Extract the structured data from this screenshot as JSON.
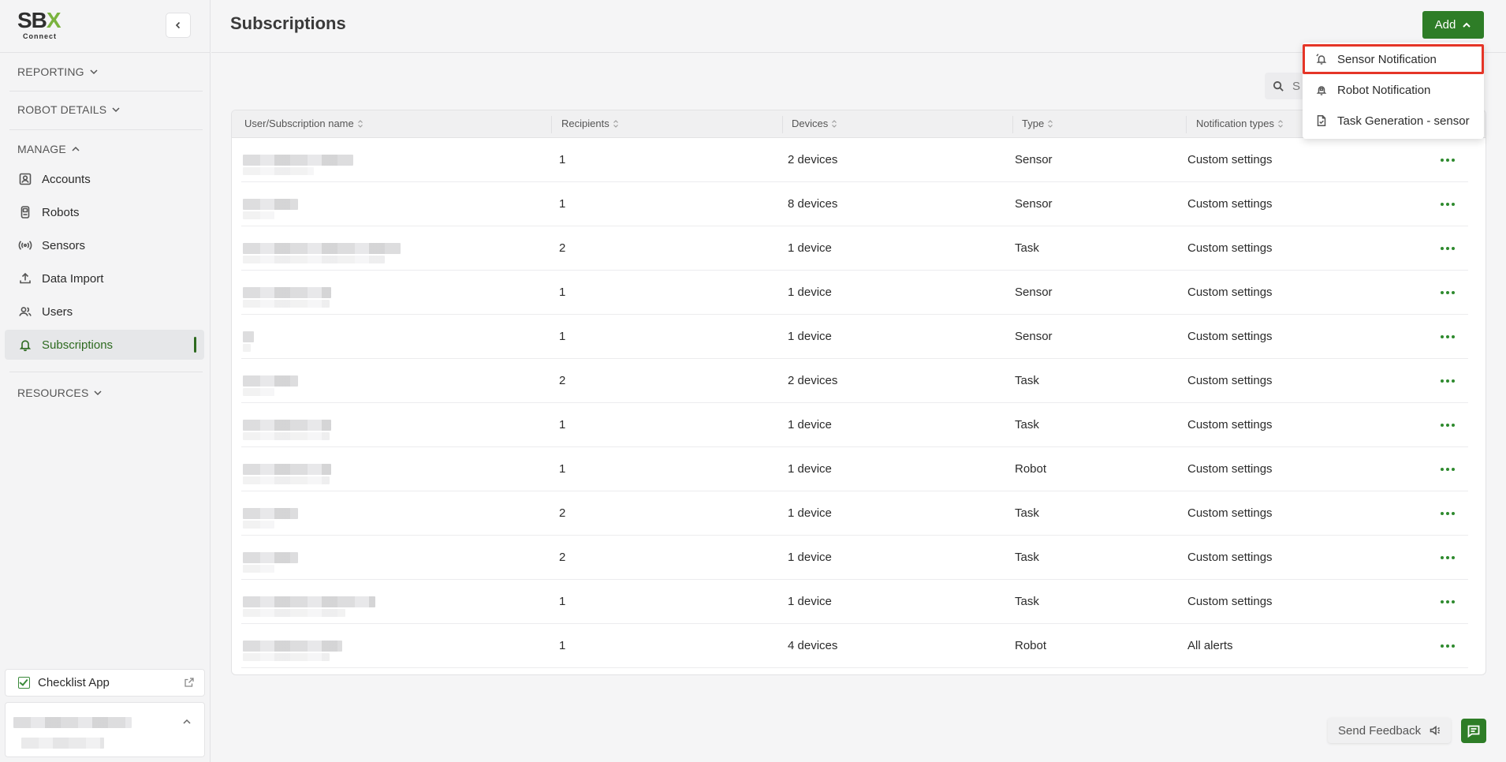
{
  "brand": {
    "logo_main_a": "SB",
    "logo_main_b": "X",
    "logo_sub": "Connect",
    "accent": "#2e7d27"
  },
  "sidebar": {
    "sections": {
      "reporting": "REPORTING",
      "robot_details": "ROBOT DETAILS",
      "manage": "MANAGE",
      "resources": "RESOURCES"
    },
    "items": [
      {
        "label": "Accounts",
        "icon": "accounts-icon"
      },
      {
        "label": "Robots",
        "icon": "robot-icon"
      },
      {
        "label": "Sensors",
        "icon": "sensor-icon"
      },
      {
        "label": "Data Import",
        "icon": "upload-icon"
      },
      {
        "label": "Users",
        "icon": "users-icon"
      },
      {
        "label": "Subscriptions",
        "icon": "bell-icon",
        "active": true
      }
    ],
    "checklist_label": "Checklist App"
  },
  "header": {
    "title": "Subscriptions",
    "add_label": "Add"
  },
  "search": {
    "placeholder": "S"
  },
  "table": {
    "columns": [
      "User/Subscription name",
      "Recipients",
      "Devices",
      "Type",
      "Notification types"
    ],
    "rows": [
      {
        "recipients": "1",
        "devices": "2 devices",
        "type": "Sensor",
        "notification": "Custom settings"
      },
      {
        "recipients": "1",
        "devices": "8 devices",
        "type": "Sensor",
        "notification": "Custom settings"
      },
      {
        "recipients": "2",
        "devices": "1 device",
        "type": "Task",
        "notification": "Custom settings"
      },
      {
        "recipients": "1",
        "devices": "1 device",
        "type": "Sensor",
        "notification": "Custom settings"
      },
      {
        "recipients": "1",
        "devices": "1 device",
        "type": "Sensor",
        "notification": "Custom settings"
      },
      {
        "recipients": "2",
        "devices": "2 devices",
        "type": "Task",
        "notification": "Custom settings"
      },
      {
        "recipients": "1",
        "devices": "1 device",
        "type": "Task",
        "notification": "Custom settings"
      },
      {
        "recipients": "1",
        "devices": "1 device",
        "type": "Robot",
        "notification": "Custom settings"
      },
      {
        "recipients": "2",
        "devices": "1 device",
        "type": "Task",
        "notification": "Custom settings"
      },
      {
        "recipients": "2",
        "devices": "1 device",
        "type": "Task",
        "notification": "Custom settings"
      },
      {
        "recipients": "1",
        "devices": "1 device",
        "type": "Task",
        "notification": "Custom settings"
      },
      {
        "recipients": "1",
        "devices": "4 devices",
        "type": "Robot",
        "notification": "All alerts"
      }
    ]
  },
  "dropdown": {
    "items": [
      {
        "label": "Sensor Notification",
        "icon": "sensor-bell-icon",
        "highlighted": true
      },
      {
        "label": "Robot Notification",
        "icon": "robot-bell-icon"
      },
      {
        "label": "Task Generation - sensor",
        "icon": "task-doc-icon"
      }
    ]
  },
  "footer": {
    "feedback_label": "Send Feedback"
  }
}
